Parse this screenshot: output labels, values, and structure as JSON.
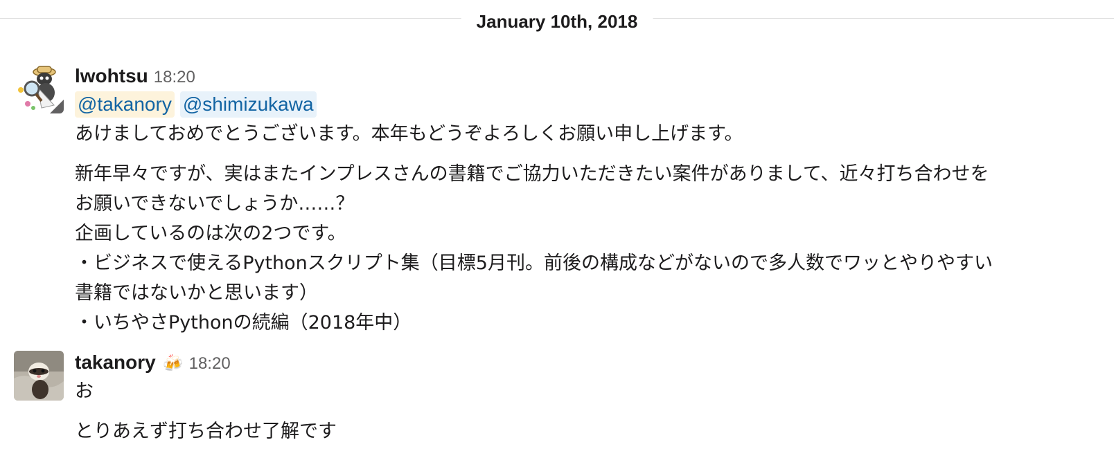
{
  "date_divider": "January 10th, 2018",
  "colors": {
    "mention_self_bg": "#fdf3dc",
    "mention_other_bg": "#e8f2fa",
    "mention_text": "#1264a3"
  },
  "messages": [
    {
      "author": "lwohtsu",
      "time": "18:20",
      "avatar_icon": "ant-detective-avatar",
      "mentions": [
        "@takanory",
        "@shimizukawa"
      ],
      "paragraphs": [
        [
          "あけましておめでとうございます。本年もどうぞよろしくお願い申し上げます。"
        ],
        [
          "新年早々ですが、実はまたインプレスさんの書籍でご協力いただきたい案件がありまして、近々打ち合わせを",
          "お願いできないでしょうか……？",
          "企画しているのは次の2つです。",
          "・ビジネスで使えるPythonスクリプト集（目標5月刊。前後の構成などがないので多人数でワッとやりやすい",
          "書籍ではないかと思います）",
          "・いちやさPythonの続編（2018年中）"
        ]
      ]
    },
    {
      "author": "takanory",
      "time": "18:20",
      "status_emoji": "🍻",
      "avatar_icon": "ferret-avatar",
      "paragraphs": [
        [
          "お"
        ],
        [
          "とりあえず打ち合わせ了解です"
        ]
      ]
    }
  ]
}
